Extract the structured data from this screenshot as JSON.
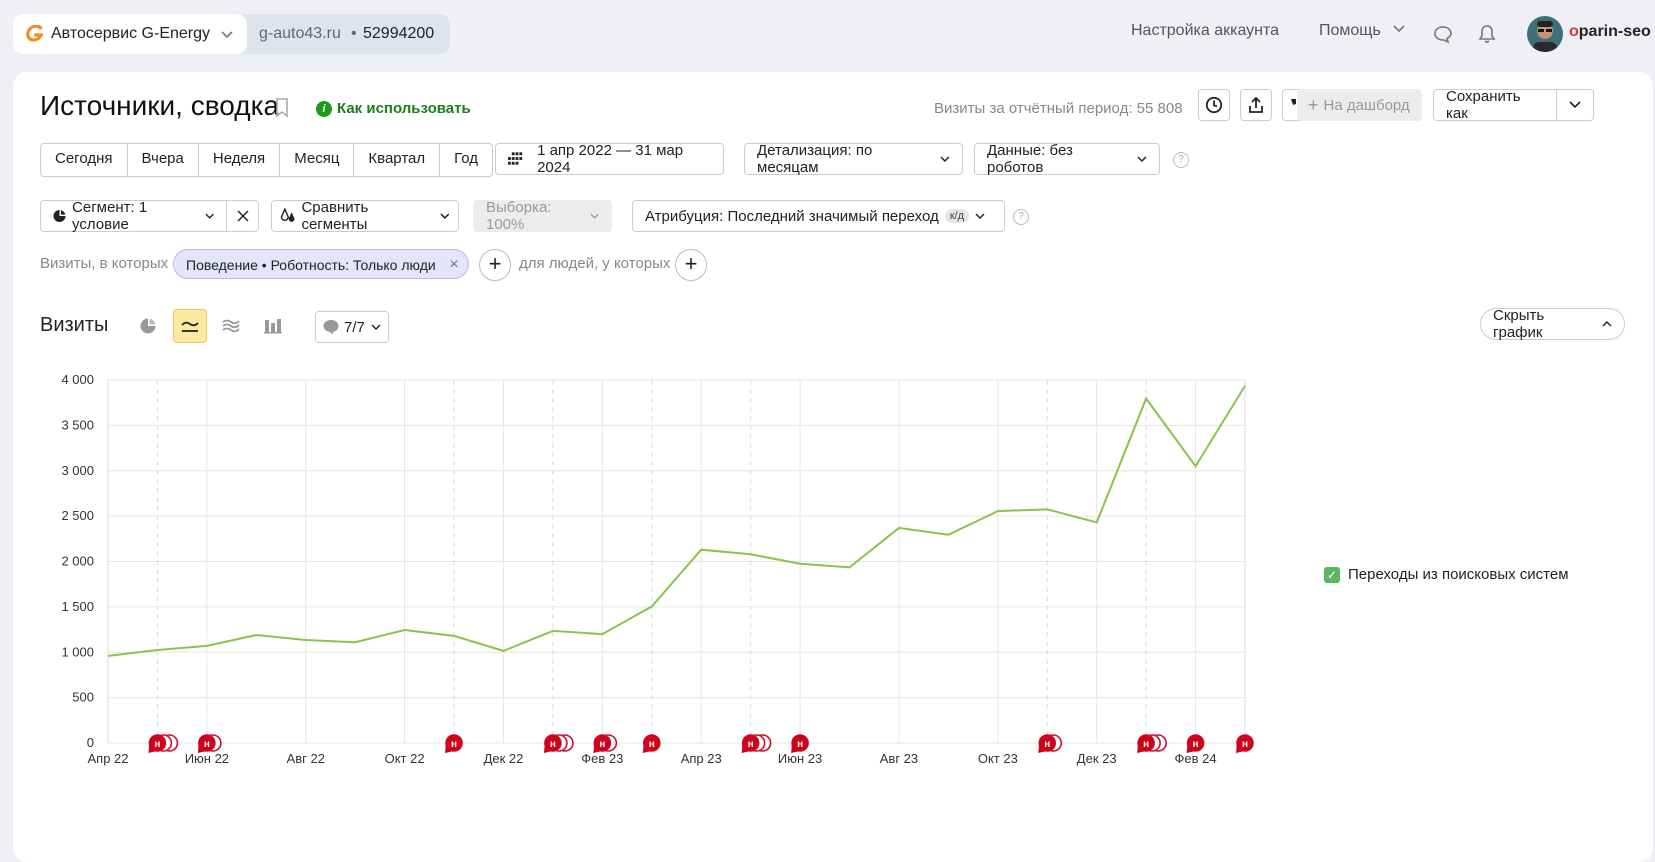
{
  "counter": {
    "name": "Автосервис G-Energy",
    "domain": "g-auto43.ru",
    "dot": "•",
    "id": "52994200"
  },
  "topnav": {
    "account_settings": "Настройка аккаунта",
    "help": "Помощь",
    "username_first": "o",
    "username_rest": "parin-seo"
  },
  "report": {
    "title": "Источники, сводка",
    "howto": "Как использовать",
    "visits_period": "Визиты за отчётный период: 55 808",
    "to_dashboard": "На дашборд",
    "save_as": "Сохранить как"
  },
  "periods": [
    "Сегодня",
    "Вчера",
    "Неделя",
    "Месяц",
    "Квартал",
    "Год"
  ],
  "date_range": "1 апр 2022 — 31 мар 2024",
  "detail": "Детализация: по месяцам",
  "data_mode": "Данные: без роботов",
  "segment": "Сегмент: 1 условие",
  "compare": "Сравнить сегменты",
  "sample": "Выборка: 100%",
  "attribution": "Атрибуция: Последний значимый переход",
  "attribution_badge": "к/д",
  "filters": {
    "visits_where": "Визиты, в которых",
    "chip": "Поведение • Роботность: Только люди",
    "people_where": "для людей, у которых"
  },
  "chart_section": {
    "title": "Визиты",
    "annotations": "7/7",
    "hide_chart": "Скрыть график"
  },
  "chart_data": {
    "type": "line",
    "x": [
      "Апр 22",
      "Май 22",
      "Июн 22",
      "Июл 22",
      "Авг 22",
      "Сен 22",
      "Окт 22",
      "Ноя 22",
      "Дек 22",
      "Янв 23",
      "Фев 23",
      "Мар 23",
      "Апр 23",
      "Май 23",
      "Июн 23",
      "Июл 23",
      "Авг 23",
      "Сен 23",
      "Окт 23",
      "Ноя 23",
      "Дек 23",
      "Янв 24",
      "Фев 24",
      "Мар 24"
    ],
    "tick_labels": [
      "Апр 22",
      "Июн 22",
      "Авг 22",
      "Окт 22",
      "Дек 22",
      "Фев 23",
      "Апр 23",
      "Июн 23",
      "Авг 23",
      "Окт 23",
      "Дек 23",
      "Фев 24"
    ],
    "y_ticks": [
      "0",
      "500",
      "1 000",
      "1 500",
      "2 000",
      "2 500",
      "3 000",
      "3 500",
      "4 000"
    ],
    "ylim": [
      0,
      4000
    ],
    "series": [
      {
        "name": "Переходы из поисковых систем",
        "color": "#8bc34a",
        "values": [
          960,
          1025,
          1070,
          1190,
          1135,
          1110,
          1245,
          1180,
          1015,
          1235,
          1200,
          1505,
          2130,
          2080,
          1975,
          1935,
          2370,
          2295,
          2555,
          2575,
          2430,
          3795,
          3050,
          3935
        ]
      }
    ],
    "annotation_marker": "н",
    "annotation_markers": [
      {
        "x": "Май 22",
        "count": 3
      },
      {
        "x": "Июн 22",
        "count": 2
      },
      {
        "x": "Ноя 22",
        "count": 1
      },
      {
        "x": "Янв 23",
        "count": 3
      },
      {
        "x": "Фев 23",
        "count": 2
      },
      {
        "x": "Мар 23",
        "count": 1
      },
      {
        "x": "Май 23",
        "count": 3
      },
      {
        "x": "Июн 23",
        "count": 1
      },
      {
        "x": "Ноя 23",
        "count": 2
      },
      {
        "x": "Янв 24",
        "count": 3
      },
      {
        "x": "Фев 24",
        "count": 1
      },
      {
        "x": "Мар 24",
        "count": 1
      }
    ],
    "grid": true,
    "legend_position": "right"
  }
}
